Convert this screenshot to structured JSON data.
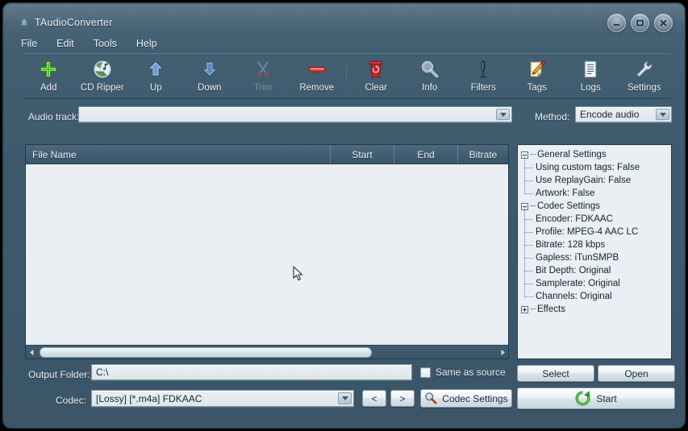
{
  "window": {
    "title": "TAudioConverter",
    "icon": "app-bell-icon",
    "minimize": "minimize-icon",
    "maximize": "maximize-icon",
    "close": "close-icon"
  },
  "menu": {
    "items": [
      "File",
      "Edit",
      "Tools",
      "Help"
    ]
  },
  "toolbar": {
    "buttons": [
      {
        "label": "Add",
        "icon": "plus-icon",
        "disabled": false
      },
      {
        "label": "CD Ripper",
        "icon": "cd-music-icon",
        "disabled": false
      },
      {
        "label": "Up",
        "icon": "arrow-up-icon",
        "disabled": false
      },
      {
        "label": "Down",
        "icon": "arrow-down-icon",
        "disabled": false
      },
      {
        "label": "Trim",
        "icon": "scissors-icon",
        "disabled": true
      },
      {
        "label": "Remove",
        "icon": "minus-bar-icon",
        "disabled": false
      },
      {
        "label": "Clear",
        "icon": "trash-icon",
        "disabled": false
      },
      {
        "label": "Info",
        "icon": "magnifier-icon",
        "disabled": false
      },
      {
        "label": "Filters",
        "icon": "microphone-icon",
        "disabled": false
      },
      {
        "label": "Tags",
        "icon": "pencil-note-icon",
        "disabled": false
      },
      {
        "label": "Logs",
        "icon": "document-icon",
        "disabled": false
      },
      {
        "label": "Settings",
        "icon": "wrench-icon",
        "disabled": false
      }
    ]
  },
  "track_row": {
    "label": "Audio track:",
    "value": "",
    "method_label": "Method:",
    "method_value": "Encode audio"
  },
  "file_list": {
    "columns": [
      "File Name",
      "Start",
      "End",
      "Bitrate"
    ],
    "rows": [],
    "scroll_left_icon": "scroll-left-arrow-icon",
    "scroll_right_icon": "scroll-right-arrow-icon"
  },
  "settings_tree": [
    {
      "label": "General Settings",
      "level": 0,
      "state": "expanded"
    },
    {
      "label": "Using custom tags: False",
      "level": 1,
      "state": "leaf"
    },
    {
      "label": "Use ReplayGain: False",
      "level": 1,
      "state": "leaf"
    },
    {
      "label": "Artwork: False",
      "level": 1,
      "state": "leaf"
    },
    {
      "label": "Codec Settings",
      "level": 0,
      "state": "expanded"
    },
    {
      "label": "Encoder: FDKAAC",
      "level": 1,
      "state": "leaf"
    },
    {
      "label": "Profile: MPEG-4 AAC LC",
      "level": 1,
      "state": "leaf"
    },
    {
      "label": "Bitrate: 128 kbps",
      "level": 1,
      "state": "leaf"
    },
    {
      "label": "Gapless: iTunSMPB",
      "level": 1,
      "state": "leaf"
    },
    {
      "label": "Bit Depth: Original",
      "level": 1,
      "state": "leaf"
    },
    {
      "label": "Samplerate: Original",
      "level": 1,
      "state": "leaf"
    },
    {
      "label": "Channels: Original",
      "level": 1,
      "state": "leaf"
    },
    {
      "label": "Effects",
      "level": 0,
      "state": "collapsed"
    }
  ],
  "bottom": {
    "output_folder_label": "Output Folder:",
    "output_folder_value": "C:\\",
    "same_as_source_label": "Same as source",
    "same_as_source_checked": false,
    "select_label": "Select",
    "open_label": "Open",
    "codec_label": "Codec:",
    "codec_value": "[Lossy] [*.m4a] FDKAAC",
    "prev_label": "<",
    "next_label": ">",
    "codec_settings_label": "Codec Settings",
    "codec_settings_icon": "magnifier-tool-icon",
    "start_label": "Start",
    "start_icon": "green-refresh-icon"
  },
  "colors": {
    "window_bg": "#3f5b6e",
    "panel_bg": "#e9eff2",
    "text_light": "#e9eff3",
    "text_dark": "#14222b",
    "accent_green": "#2f9e2f",
    "accent_red": "#cc2222",
    "border_dark": "#23394a"
  }
}
